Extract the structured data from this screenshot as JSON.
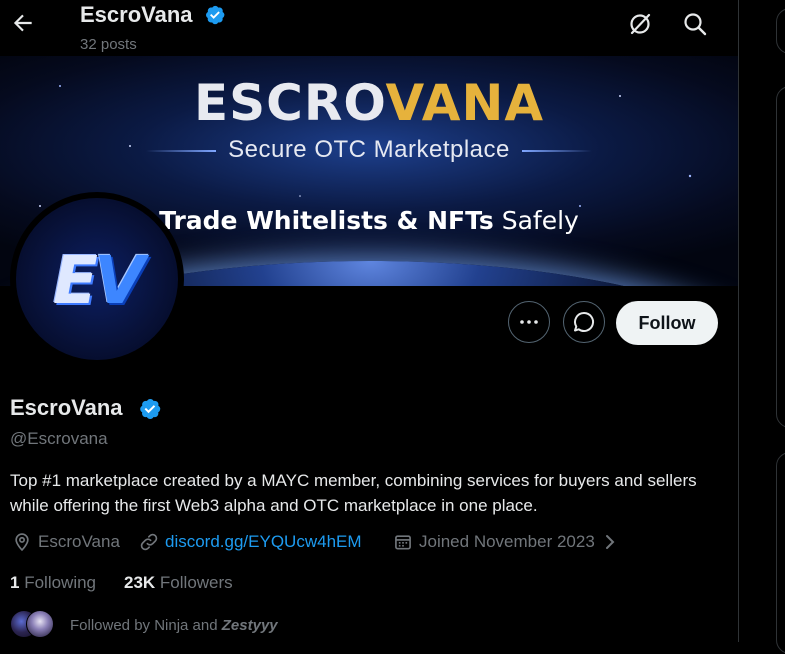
{
  "header": {
    "name": "EscroVana",
    "posts": "32 posts",
    "back_icon": "arrow-left-icon",
    "icons": [
      "grok-icon",
      "search-icon"
    ]
  },
  "banner": {
    "title_part1": "ESCRO",
    "title_part2": "VANA",
    "subtitle": "Secure OTC Marketplace",
    "tagline_bold": "Trade Whitelists & NFTs",
    "tagline_rest": "Safely"
  },
  "avatar": {
    "text_e": "E",
    "text_v": "V"
  },
  "actions": {
    "more_icon": "more-dots-icon",
    "message_icon": "message-icon",
    "follow_label": "Follow"
  },
  "profile": {
    "name": "EscroVana",
    "handle": "@Escrovana",
    "bio": "Top #1 marketplace created by a MAYC member, combining services for buyers and sellers while offering the first Web3 alpha and OTC marketplace in one place.",
    "location": "EscroVana",
    "link": "discord.gg/EYQUcw4hEM",
    "joined": "Joined November 2023",
    "following_count": "1",
    "following_label": "Following",
    "followers_count": "23K",
    "followers_label": "Followers",
    "followed_by_prefix": "Followed by Ninja and",
    "followed_by_name": "Zestyyy"
  },
  "colors": {
    "accent": "#1d9bf0",
    "verified": "#1d9bf0",
    "muted": "#71767b",
    "brand_gold": "#e6b23c"
  }
}
